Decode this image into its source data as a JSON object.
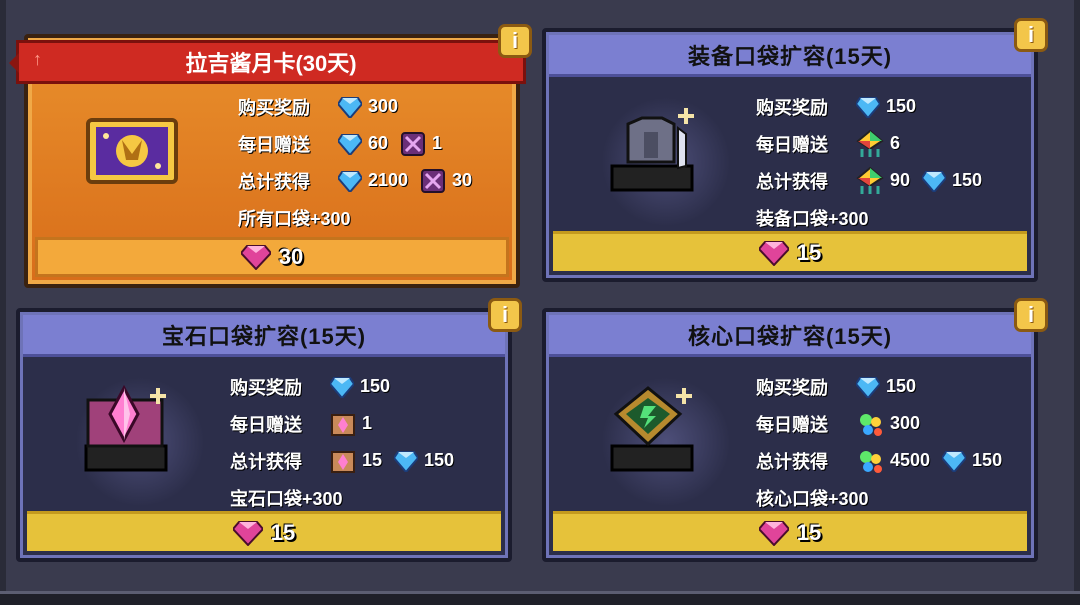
{
  "cards": [
    {
      "title": "拉吉酱月卡(30天)",
      "rows": [
        {
          "label": "购买奖励",
          "v1": "300"
        },
        {
          "label": "每日赠送",
          "v1": "60",
          "v2": "1"
        },
        {
          "label": "总计获得",
          "v1": "2100",
          "v2": "30"
        },
        {
          "label": "所有口袋+300"
        }
      ],
      "price": "30",
      "icons": {
        "item": "golden-card-icon",
        "v1": "blue-diamond-icon",
        "v2": "purple-box-icon"
      }
    },
    {
      "title": "装备口袋扩容(15天)",
      "rows": [
        {
          "label": "购买奖励",
          "v1": "150"
        },
        {
          "label": "每日赠送",
          "v1": "6"
        },
        {
          "label": "总计获得",
          "v1": "90",
          "v2": "150"
        },
        {
          "label": "装备口袋+300"
        }
      ],
      "price": "15",
      "icons": {
        "item": "armor-pocket-icon",
        "v1": "rainbow-crystal-icon",
        "v2": "blue-diamond-icon"
      }
    },
    {
      "title": "宝石口袋扩容(15天)",
      "rows": [
        {
          "label": "购买奖励",
          "v1": "150"
        },
        {
          "label": "每日赠送",
          "v1": "1"
        },
        {
          "label": "总计获得",
          "v1": "15",
          "v2": "150"
        },
        {
          "label": "宝石口袋+300"
        }
      ],
      "price": "15",
      "icons": {
        "item": "gem-pocket-icon",
        "v1": "gem-crate-icon",
        "v2": "blue-diamond-icon"
      }
    },
    {
      "title": "核心口袋扩容(15天)",
      "rows": [
        {
          "label": "购买奖励",
          "v1": "150"
        },
        {
          "label": "每日赠送",
          "v1": "300"
        },
        {
          "label": "总计获得",
          "v1": "4500",
          "v2": "150"
        },
        {
          "label": "核心口袋+300"
        }
      ],
      "price": "15",
      "icons": {
        "item": "core-pocket-icon",
        "v1": "energy-orbs-icon",
        "v2": "blue-diamond-icon"
      }
    }
  ],
  "colors": {
    "header": "#7b7fd1",
    "ribbon": "#cf2a22",
    "price_bar": "#e6c23a",
    "gold_card": "#e9902c"
  }
}
